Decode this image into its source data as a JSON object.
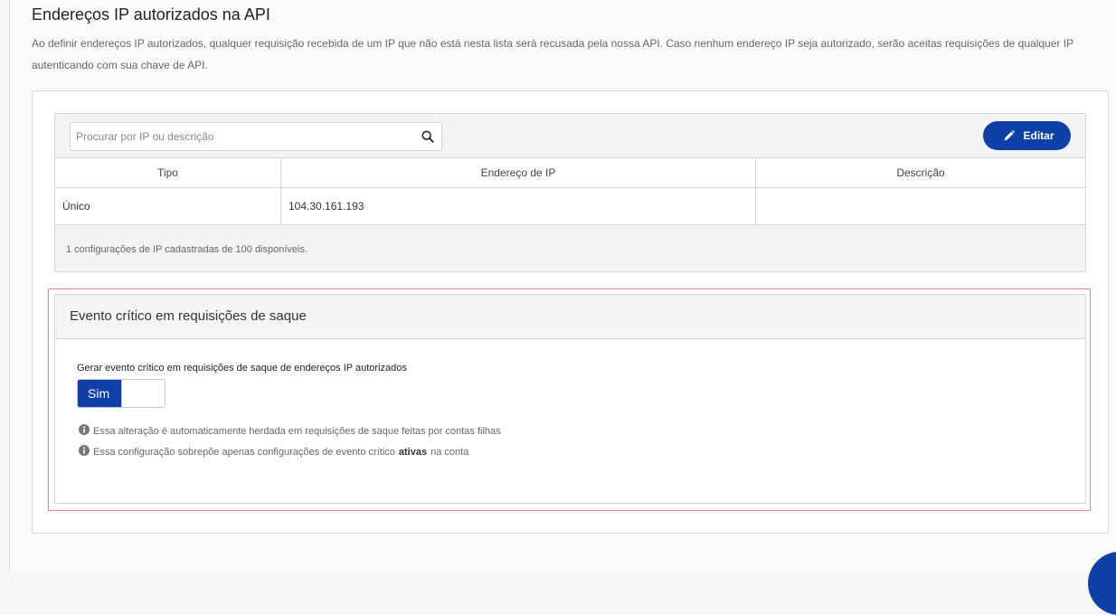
{
  "page": {
    "title": "Endereços IP autorizados na API",
    "description": "Ao definir endereços IP autorizados, qualquer requisição recebida de um IP que não está nesta lista será recusada pela nossa API. Caso nenhum endereço IP seja autorizado, serão aceitas requisições de qualquer IP autenticando com sua chave de API."
  },
  "search": {
    "placeholder": "Procurar por IP ou descrição",
    "value": "",
    "icon": "search-icon"
  },
  "toolbar": {
    "edit_label": "Editar",
    "edit_icon": "pencil-icon"
  },
  "table": {
    "headers": [
      "Tipo",
      "Endereço de IP",
      "Descrição"
    ],
    "rows": [
      {
        "tipo": "Único",
        "endereco": "104.30.161.193",
        "descricao": ""
      }
    ],
    "footer": "1 configurações de IP cadastradas de 100 disponíveis."
  },
  "critical_event": {
    "title": "Evento crítico em requisições de saque",
    "toggle_label": "Gerar evento crítico em requisições de saque de endereços IP autorizados",
    "toggle_on_label": "Sim",
    "toggle_state": true,
    "info_1": "Essa alteração é automaticamente herdada em requisições de saque feitas por contas filhas",
    "info_2_before": "Essa configuração sobrepõe apenas configurações de evento crítico",
    "info_2_bold": "ativas",
    "info_2_after": "na conta",
    "info_icon": "info-circle-icon"
  },
  "colors": {
    "primary": "#0f40a8",
    "highlight_border": "#e8868b"
  }
}
